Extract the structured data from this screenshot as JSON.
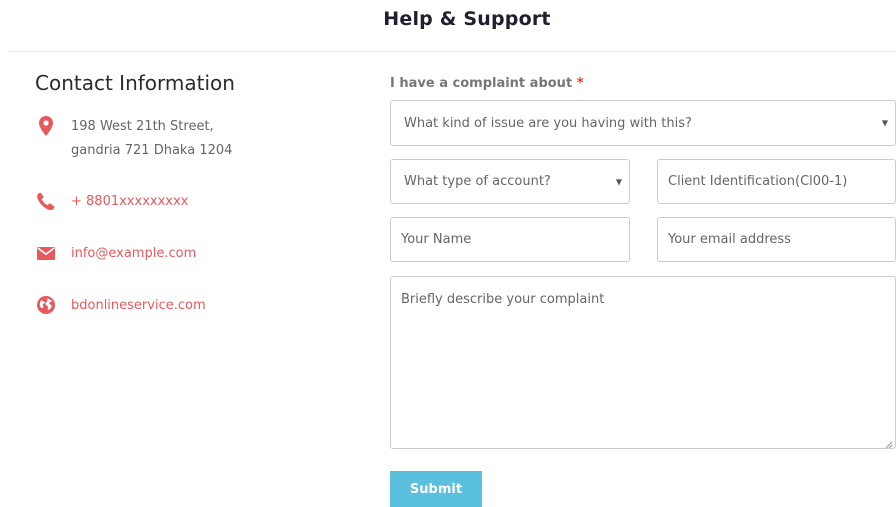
{
  "header": {
    "title": "Help & Support"
  },
  "contact": {
    "heading": "Contact Information",
    "items": [
      {
        "icon": "map-pin-icon",
        "text": "198 West 21th Street,\ngandria 721 Dhaka 1204"
      },
      {
        "icon": "phone-icon",
        "text": "+ 8801xxxxxxxxx"
      },
      {
        "icon": "envelope-icon",
        "text": "info@example.com"
      },
      {
        "icon": "globe-icon",
        "text": "bdonlineservice.com"
      }
    ]
  },
  "form": {
    "complaint_label": "I have a complaint about",
    "required_marker": "*",
    "issue_select": {
      "value": "What kind of issue are you having with this?"
    },
    "account_select": {
      "value": "What type of account?"
    },
    "client_id": {
      "placeholder": "Client Identification(Cl00-1)"
    },
    "name": {
      "placeholder": "Your Name"
    },
    "email": {
      "placeholder": "Your email address"
    },
    "complaint": {
      "placeholder": "Briefly describe your complaint"
    },
    "submit_label": "Submit"
  },
  "colors": {
    "accent": "#e8595e",
    "button": "#5bc0de",
    "border": "#cccccc"
  }
}
